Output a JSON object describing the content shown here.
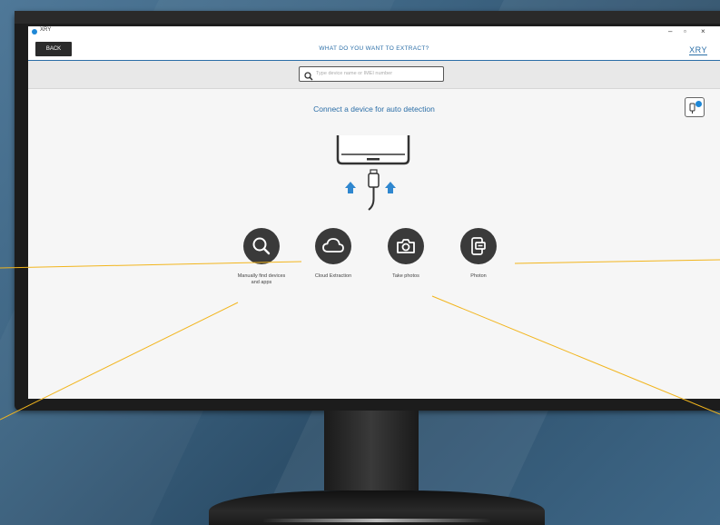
{
  "window": {
    "title": "XRY"
  },
  "header": {
    "back_label": "BACK",
    "title": "WHAT DO YOU WANT TO EXTRACT?",
    "brand": "XRY"
  },
  "search": {
    "placeholder": "Type device name or IMEI number"
  },
  "main": {
    "connect_text": "Connect a device for auto detection"
  },
  "actions": [
    {
      "label": "Manually find devices and apps",
      "icon": "magnifier-icon"
    },
    {
      "label": "Cloud Extraction",
      "icon": "cloud-icon"
    },
    {
      "label": "Take photos",
      "icon": "camera-icon"
    },
    {
      "label": "Photon",
      "icon": "photon-device-icon"
    }
  ],
  "colors": {
    "accent": "#2b6ea7",
    "badge": "#1e87d6",
    "action_circle": "#3a3a3a",
    "callout_line": "#f2b51d"
  }
}
